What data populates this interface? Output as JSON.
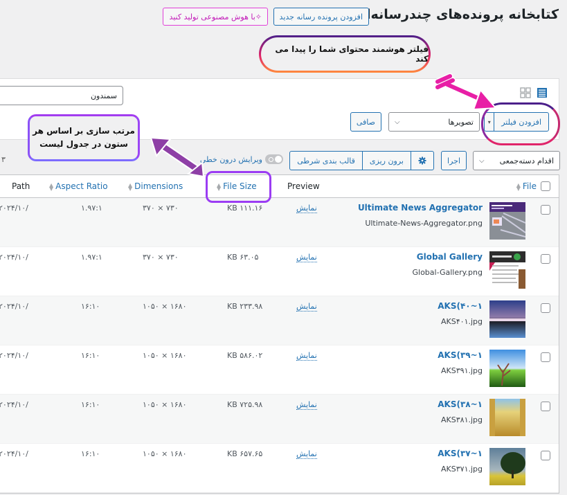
{
  "header": {
    "title": "کتابخانه پرونده‌های چندرسانه‌ای",
    "add_media_label": "افزودن پرونده رسانه جدید",
    "ai_generate_label": "✧با هوش مصنوعی تولید کنید"
  },
  "annotations": {
    "filter_callout": "فیلتر هوشمند محتوای شما را پیدا می کند",
    "sort_callout_line1": "مرتب سازی بر اساس هر",
    "sort_callout_line2": "ستون در جدول لیست",
    "colors": {
      "pink": "#e0246a",
      "purple": "#9b3cf3",
      "orange": "#ff8a3d",
      "arrow_pink": "#e81fa6",
      "arrow_purple": "#8e3fa6"
    }
  },
  "filters": {
    "search_value": "سمندون",
    "add_filter_label": "افزودن فیلتر",
    "type_select_value": "تصویرها",
    "clear_label": "صافی",
    "view_grid_icon": "grid-view-icon",
    "view_list_icon": "list-view-icon"
  },
  "toolbar": {
    "bulk_action_value": "اقدام دسته‌جمعی",
    "apply_label": "اجرا",
    "settings_icon": "gear-icon",
    "export_label": "برون ریزی",
    "conditional_format_label": "قالب بندی شرطی",
    "inline_edit_label": "ویرایش درون خطی",
    "page_count": "۳"
  },
  "table": {
    "columns": {
      "file": "File",
      "preview": "Preview",
      "file_size": "File Size",
      "dimensions": "Dimensions",
      "aspect_ratio": "Aspect Ratio",
      "path": "Path"
    },
    "rows": [
      {
        "title": "Ultimate News Aggregator",
        "filename": "Ultimate-News-Aggregator.png",
        "preview": "نمایش",
        "size": "KB ۱۱۱.۱۶",
        "dimensions": "۳۷۰ × ۷۳۰",
        "ratio": "۱.۹۷:۱",
        "path": "۲۰۲۴/۱۰/",
        "thumb": "purple-news"
      },
      {
        "title": "Global Gallery",
        "filename": "Global-Gallery.png",
        "preview": "نمایش",
        "size": "KB ۶۳.۰۵",
        "dimensions": "۳۷۰ × ۷۳۰",
        "ratio": "۱.۹۷:۱",
        "path": "۲۰۲۴/۱۰/",
        "thumb": "gallery-doc"
      },
      {
        "title": "AKS(۴۰~۱",
        "filename": "AKS۴۰۱.jpg",
        "preview": "نمایش",
        "size": "KB ۲۳۳.۹۸",
        "dimensions": "۱۰۵۰ × ۱۶۸۰",
        "ratio": "۱۶:۱۰",
        "path": "۲۰۲۴/۱۰/",
        "thumb": "sunset"
      },
      {
        "title": "AKS(۳۹~۱",
        "filename": "AKS۳۹۱.jpg",
        "preview": "نمایش",
        "size": "KB ۵۸۶.۰۲",
        "dimensions": "۱۰۵۰ × ۱۶۸۰",
        "ratio": "۱۶:۱۰",
        "path": "۲۰۲۴/۱۰/",
        "thumb": "tree-field"
      },
      {
        "title": "AKS(۳۸~۱",
        "filename": "AKS۳۸۱.jpg",
        "preview": "نمایش",
        "size": "KB ۷۲۵.۹۸",
        "dimensions": "۱۰۵۰ × ۱۶۸۰",
        "ratio": "۱۶:۱۰",
        "path": "۲۰۲۴/۱۰/",
        "thumb": "wheat"
      },
      {
        "title": "AKS(۳۷~۱",
        "filename": "AKS۳۷۱.jpg",
        "preview": "نمایش",
        "size": "KB ۶۵۷.۶۵",
        "dimensions": "۱۰۵۰ × ۱۶۸۰",
        "ratio": "۱۶:۱۰",
        "path": "۲۰۲۴/۱۰/",
        "thumb": "oak-meadow"
      }
    ]
  }
}
